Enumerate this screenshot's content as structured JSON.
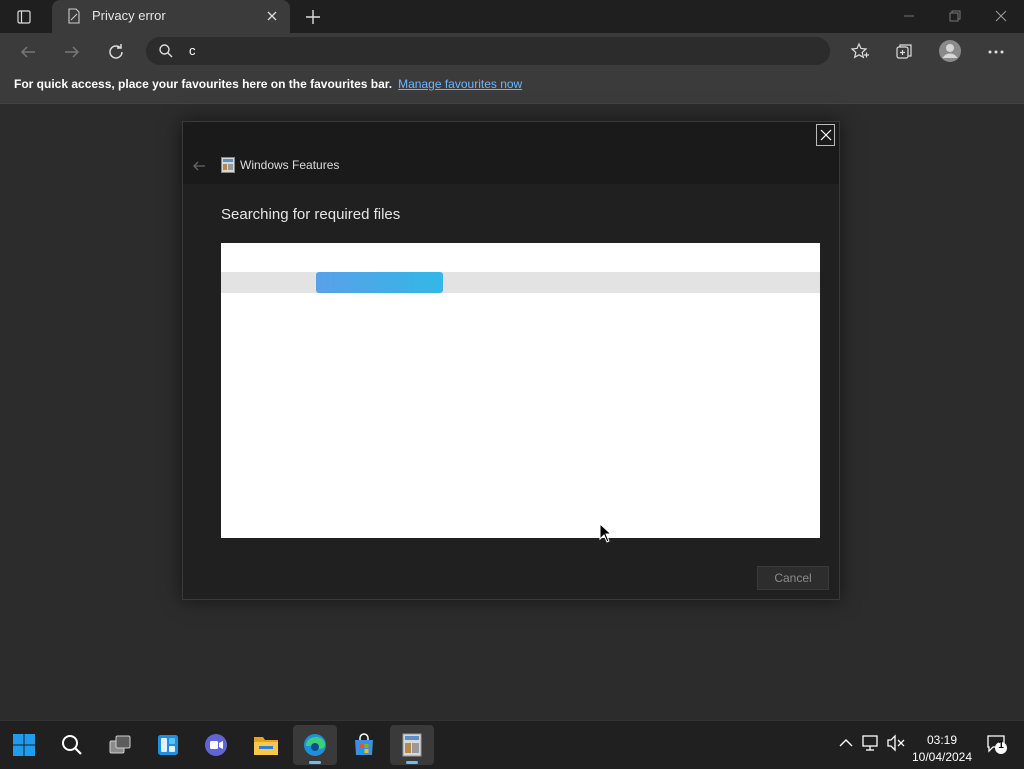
{
  "browser": {
    "tab": {
      "title": "Privacy error"
    },
    "address": {
      "value": "c"
    },
    "favbar": {
      "message": "For quick access, place your favourites here on the favourites bar.",
      "link": "Manage favourites now"
    }
  },
  "dialog": {
    "window_title": "Windows Features",
    "heading": "Searching for required files",
    "cancel_label": "Cancel",
    "progress": {
      "indeterminate": true
    }
  },
  "taskbar": {
    "time": "03:19",
    "date": "10/04/2024",
    "notification_count": "1",
    "apps": [
      "start",
      "search",
      "task-view",
      "widgets",
      "chat",
      "file-explorer",
      "edge",
      "store",
      "windows-features"
    ]
  },
  "colors": {
    "accent": "#76b9ed",
    "link": "#6cb6ff",
    "progress": "#3fa9e8"
  }
}
